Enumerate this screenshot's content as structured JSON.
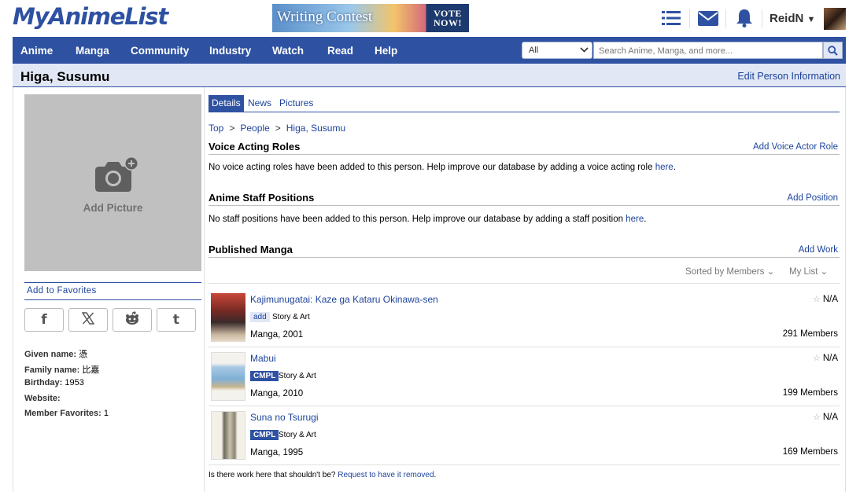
{
  "header": {
    "logo": "MyAnimeList",
    "banner_text": "Writing Contest",
    "banner_vote_1": "VOTE",
    "banner_vote_2": "NOW!",
    "user_name": "ReidN",
    "icons": [
      "list-icon",
      "mail-icon",
      "bell-icon"
    ]
  },
  "nav": {
    "items": [
      "Anime",
      "Manga",
      "Community",
      "Industry",
      "Watch",
      "Read",
      "Help"
    ],
    "select_value": "All",
    "search_placeholder": "Search Anime, Manga, and more..."
  },
  "title_bar": {
    "title": "Higa, Susumu",
    "edit_label": "Edit Person Information"
  },
  "sidebar": {
    "add_picture": "Add Picture",
    "add_to_favorites": "Add to Favorites",
    "share": [
      "f",
      "X",
      "reddit",
      "t"
    ],
    "info": [
      {
        "label": "Given name:",
        "value": "憑"
      },
      {
        "label": "Family name:",
        "value": "比嘉"
      },
      {
        "label": "Birthday:",
        "value": "1953"
      },
      {
        "label": "Website:",
        "value": ""
      },
      {
        "label": "Member Favorites:",
        "value": "1"
      }
    ]
  },
  "main": {
    "tabs": [
      "Details",
      "News",
      "Pictures"
    ],
    "breadcrumb": [
      "Top",
      "People",
      "Higa, Susumu"
    ],
    "voice_section": {
      "title": "Voice Acting Roles",
      "action": "Add Voice Actor Role",
      "text": "No voice acting roles have been added to this person. Help improve our database by adding a voice acting role ",
      "link": "here",
      "end": "."
    },
    "staff_section": {
      "title": "Anime Staff Positions",
      "action": "Add Position",
      "text": "No staff positions have been added to this person. Help improve our database by adding a staff position ",
      "link": "here",
      "end": "."
    },
    "manga_section": {
      "title": "Published Manga",
      "action": "Add Work",
      "sort_label": "Sorted by Members",
      "list_label": "My List"
    },
    "manga": [
      {
        "title": "Kajimunugatai: Kaze ga Kataru Okinawa-sen",
        "badge": "add",
        "role": "Story & Art",
        "meta": "Manga, 2001",
        "score": "N/A",
        "members": "291 Members"
      },
      {
        "title": "Mabui",
        "badge": "CMPL",
        "role": "Story & Art",
        "meta": "Manga, 2010",
        "score": "N/A",
        "members": "199 Members"
      },
      {
        "title": "Suna no Tsurugi",
        "badge": "CMPL",
        "role": "Story & Art",
        "meta": "Manga, 1995",
        "score": "N/A",
        "members": "169 Members"
      }
    ],
    "footer_text": "Is there work here that shouldn't be? ",
    "footer_link": "Request to have it removed",
    "footer_end": "."
  },
  "colors": {
    "brand": "#2e51a2",
    "link": "#1c439b",
    "title_bg": "#e1e7f5"
  }
}
